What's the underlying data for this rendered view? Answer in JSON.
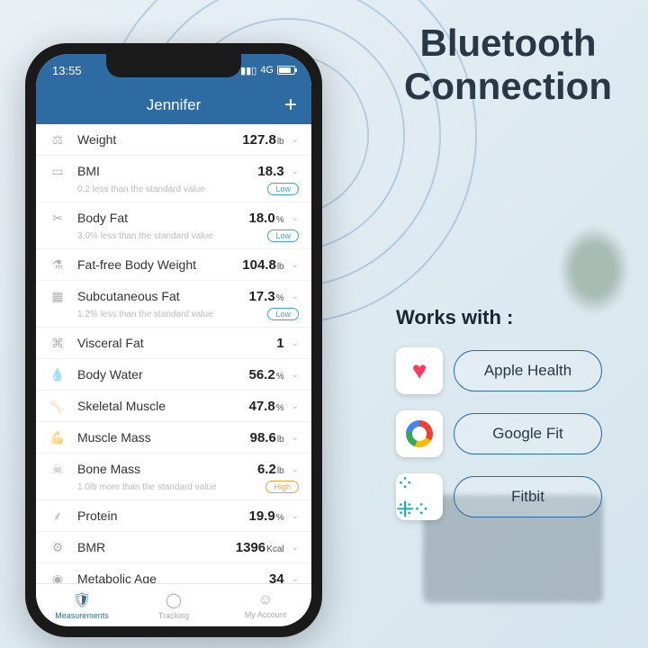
{
  "headline_l1": "Bluetooth",
  "headline_l2": "Connection",
  "works_with": "Works with :",
  "integrations": [
    {
      "name": "Apple Health"
    },
    {
      "name": "Google Fit"
    },
    {
      "name": "Fitbit"
    }
  ],
  "status": {
    "time": "13:55",
    "net": "4G"
  },
  "appbar": {
    "title": "Jennifer",
    "plus": "+"
  },
  "metrics": [
    {
      "icon": "⚖",
      "label": "Weight",
      "value": "127.8",
      "unit": "lb"
    },
    {
      "icon": "▭",
      "label": "BMI",
      "value": "18.3",
      "unit": "",
      "note": "0.2 less than the standard value",
      "badge": "Low",
      "badgeClass": "badge-low"
    },
    {
      "icon": "✂",
      "label": "Body Fat",
      "value": "18.0",
      "unit": "%",
      "note": "3.0% less than the standard value",
      "badge": "Low",
      "badgeClass": "badge-low"
    },
    {
      "icon": "⚗",
      "label": "Fat-free Body Weight",
      "value": "104.8",
      "unit": "lb"
    },
    {
      "icon": "▦",
      "label": "Subcutaneous Fat",
      "value": "17.3",
      "unit": "%",
      "note": "1.2% less than the standard value",
      "badge": "Low",
      "badgeClass": "badge-low"
    },
    {
      "icon": "⌘",
      "label": "Visceral Fat",
      "value": "1",
      "unit": ""
    },
    {
      "icon": "💧",
      "label": "Body Water",
      "value": "56.2",
      "unit": "%"
    },
    {
      "icon": "🦴",
      "label": "Skeletal Muscle",
      "value": "47.8",
      "unit": "%"
    },
    {
      "icon": "💪",
      "label": "Muscle Mass",
      "value": "98.6",
      "unit": "lb"
    },
    {
      "icon": "☠",
      "label": "Bone Mass",
      "value": "6.2",
      "unit": "lb",
      "note": "1.0lb more than the standard value",
      "badge": "High",
      "badgeClass": "badge-high"
    },
    {
      "icon": "⸙",
      "label": "Protein",
      "value": "19.9",
      "unit": "%"
    },
    {
      "icon": "⚙",
      "label": "BMR",
      "value": "1396",
      "unit": "Kcal"
    },
    {
      "icon": "◉",
      "label": "Metabolic Age",
      "value": "34",
      "unit": ""
    }
  ],
  "tabs": [
    {
      "icon": "🛡",
      "label": "Measurements",
      "active": true
    },
    {
      "icon": "◯",
      "label": "Tracking",
      "active": false
    },
    {
      "icon": "☺",
      "label": "My Account",
      "active": false
    }
  ]
}
